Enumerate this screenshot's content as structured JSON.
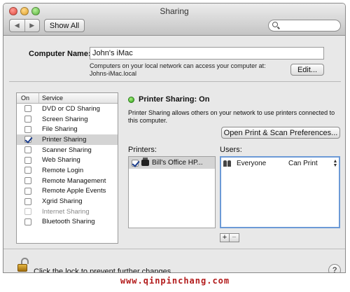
{
  "window": {
    "title": "Sharing",
    "nav_back": "◀",
    "nav_forward": "▶",
    "show_all_label": "Show All",
    "search_placeholder": ""
  },
  "computer_name": {
    "label": "Computer Name:",
    "value": "John's iMac",
    "info_line1": "Computers on your local network can access your computer at:",
    "info_line2": "Johns-iMac.local",
    "edit_label": "Edit..."
  },
  "services": {
    "header_on": "On",
    "header_service": "Service",
    "items": [
      {
        "label": "DVD or CD Sharing",
        "checked": false,
        "selected": false,
        "dim": false
      },
      {
        "label": "Screen Sharing",
        "checked": false,
        "selected": false,
        "dim": false
      },
      {
        "label": "File Sharing",
        "checked": false,
        "selected": false,
        "dim": false
      },
      {
        "label": "Printer Sharing",
        "checked": true,
        "selected": true,
        "dim": false
      },
      {
        "label": "Scanner Sharing",
        "checked": false,
        "selected": false,
        "dim": false
      },
      {
        "label": "Web Sharing",
        "checked": false,
        "selected": false,
        "dim": false
      },
      {
        "label": "Remote Login",
        "checked": false,
        "selected": false,
        "dim": false
      },
      {
        "label": "Remote Management",
        "checked": false,
        "selected": false,
        "dim": false
      },
      {
        "label": "Remote Apple Events",
        "checked": false,
        "selected": false,
        "dim": false
      },
      {
        "label": "Xgrid Sharing",
        "checked": false,
        "selected": false,
        "dim": false
      },
      {
        "label": "Internet Sharing",
        "checked": false,
        "selected": false,
        "dim": true
      },
      {
        "label": "Bluetooth Sharing",
        "checked": false,
        "selected": false,
        "dim": false
      }
    ]
  },
  "detail": {
    "status": "Printer Sharing: On",
    "description": "Printer Sharing allows others on your network to use printers connected to this computer.",
    "prefs_button": "Open Print & Scan Preferences...",
    "printers_label": "Printers:",
    "users_label": "Users:",
    "printers": [
      {
        "name": "Bill's Office HP...",
        "checked": true
      }
    ],
    "users": [
      {
        "name": "Everyone",
        "permission": "Can Print"
      }
    ],
    "add_label": "+",
    "remove_label": "−"
  },
  "footer": {
    "lock_text": "Click the lock to prevent further changes.",
    "help_label": "?"
  },
  "watermark": "www.qinpinchang.com",
  "colors": {
    "status_green": "#2d9c17",
    "selection_gray": "#d4d4d4",
    "focus_ring": "#6c9ad6",
    "watermark_red": "#b21b1b"
  }
}
